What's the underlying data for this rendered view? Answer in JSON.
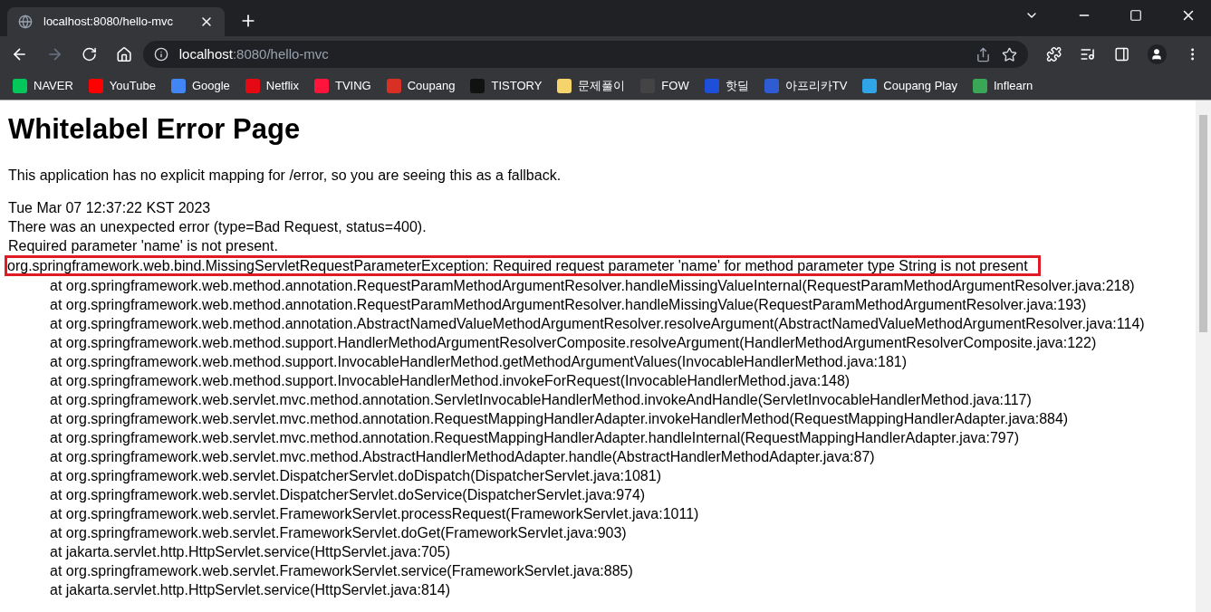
{
  "tab": {
    "title": "localhost:8080/hello-mvc",
    "selected": true
  },
  "address": {
    "host": "localhost",
    "path": ":8080/hello-mvc"
  },
  "bookmarks": [
    {
      "label": "NAVER",
      "color": "#03c75a"
    },
    {
      "label": "YouTube",
      "color": "#ff0000"
    },
    {
      "label": "Google",
      "color": "#4285f4"
    },
    {
      "label": "Netflix",
      "color": "#e50914"
    },
    {
      "label": "TVING",
      "color": "#ff153c"
    },
    {
      "label": "Coupang",
      "color": "#d93025"
    },
    {
      "label": "TISTORY",
      "color": "#111111"
    },
    {
      "label": "문제풀이",
      "color": "#f5d46b"
    },
    {
      "label": "FOW",
      "color": "#444444"
    },
    {
      "label": "핫딜",
      "color": "#1e4fd8"
    },
    {
      "label": "아프리카TV",
      "color": "#2f5bd3"
    },
    {
      "label": "Coupang Play",
      "color": "#2fa4e7"
    },
    {
      "label": "Inflearn",
      "color": "#3aa757"
    }
  ],
  "page": {
    "heading": "Whitelabel Error Page",
    "intro": "This application has no explicit mapping for /error, so you are seeing this as a fallback.",
    "details": [
      "Tue Mar 07 12:37:22 KST 2023",
      "There was an unexpected error (type=Bad Request, status=400).",
      "Required parameter 'name' is not present."
    ],
    "exception": {
      "text": "org.springframework.web.bind.MissingServletRequestParameterException: Required request parameter 'name' for method parameter type String is not present",
      "highlighted": true
    },
    "trace": [
      "at org.springframework.web.method.annotation.RequestParamMethodArgumentResolver.handleMissingValueInternal(RequestParamMethodArgumentResolver.java:218)",
      "at org.springframework.web.method.annotation.RequestParamMethodArgumentResolver.handleMissingValue(RequestParamMethodArgumentResolver.java:193)",
      "at org.springframework.web.method.annotation.AbstractNamedValueMethodArgumentResolver.resolveArgument(AbstractNamedValueMethodArgumentResolver.java:114)",
      "at org.springframework.web.method.support.HandlerMethodArgumentResolverComposite.resolveArgument(HandlerMethodArgumentResolverComposite.java:122)",
      "at org.springframework.web.method.support.InvocableHandlerMethod.getMethodArgumentValues(InvocableHandlerMethod.java:181)",
      "at org.springframework.web.method.support.InvocableHandlerMethod.invokeForRequest(InvocableHandlerMethod.java:148)",
      "at org.springframework.web.servlet.mvc.method.annotation.ServletInvocableHandlerMethod.invokeAndHandle(ServletInvocableHandlerMethod.java:117)",
      "at org.springframework.web.servlet.mvc.method.annotation.RequestMappingHandlerAdapter.invokeHandlerMethod(RequestMappingHandlerAdapter.java:884)",
      "at org.springframework.web.servlet.mvc.method.annotation.RequestMappingHandlerAdapter.handleInternal(RequestMappingHandlerAdapter.java:797)",
      "at org.springframework.web.servlet.mvc.method.AbstractHandlerMethodAdapter.handle(AbstractHandlerMethodAdapter.java:87)",
      "at org.springframework.web.servlet.DispatcherServlet.doDispatch(DispatcherServlet.java:1081)",
      "at org.springframework.web.servlet.DispatcherServlet.doService(DispatcherServlet.java:974)",
      "at org.springframework.web.servlet.FrameworkServlet.processRequest(FrameworkServlet.java:1011)",
      "at org.springframework.web.servlet.FrameworkServlet.doGet(FrameworkServlet.java:903)",
      "at jakarta.servlet.http.HttpServlet.service(HttpServlet.java:705)",
      "at org.springframework.web.servlet.FrameworkServlet.service(FrameworkServlet.java:885)",
      "at jakarta.servlet.http.HttpServlet.service(HttpServlet.java:814)"
    ]
  }
}
